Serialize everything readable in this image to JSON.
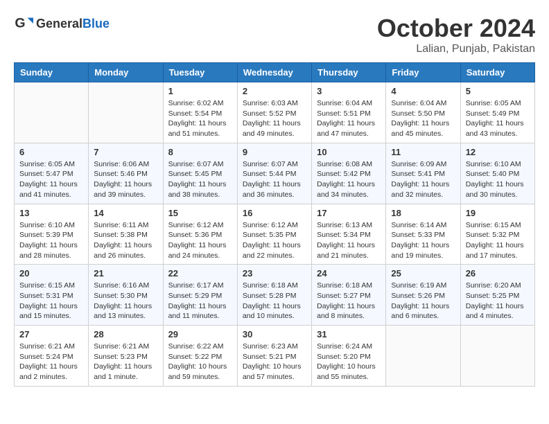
{
  "logo": {
    "text_general": "General",
    "text_blue": "Blue"
  },
  "title": {
    "month_year": "October 2024",
    "location": "Lalian, Punjab, Pakistan"
  },
  "headers": [
    "Sunday",
    "Monday",
    "Tuesday",
    "Wednesday",
    "Thursday",
    "Friday",
    "Saturday"
  ],
  "weeks": [
    [
      {
        "day": "",
        "info": ""
      },
      {
        "day": "",
        "info": ""
      },
      {
        "day": "1",
        "info": "Sunrise: 6:02 AM\nSunset: 5:54 PM\nDaylight: 11 hours and 51 minutes."
      },
      {
        "day": "2",
        "info": "Sunrise: 6:03 AM\nSunset: 5:52 PM\nDaylight: 11 hours and 49 minutes."
      },
      {
        "day": "3",
        "info": "Sunrise: 6:04 AM\nSunset: 5:51 PM\nDaylight: 11 hours and 47 minutes."
      },
      {
        "day": "4",
        "info": "Sunrise: 6:04 AM\nSunset: 5:50 PM\nDaylight: 11 hours and 45 minutes."
      },
      {
        "day": "5",
        "info": "Sunrise: 6:05 AM\nSunset: 5:49 PM\nDaylight: 11 hours and 43 minutes."
      }
    ],
    [
      {
        "day": "6",
        "info": "Sunrise: 6:05 AM\nSunset: 5:47 PM\nDaylight: 11 hours and 41 minutes."
      },
      {
        "day": "7",
        "info": "Sunrise: 6:06 AM\nSunset: 5:46 PM\nDaylight: 11 hours and 39 minutes."
      },
      {
        "day": "8",
        "info": "Sunrise: 6:07 AM\nSunset: 5:45 PM\nDaylight: 11 hours and 38 minutes."
      },
      {
        "day": "9",
        "info": "Sunrise: 6:07 AM\nSunset: 5:44 PM\nDaylight: 11 hours and 36 minutes."
      },
      {
        "day": "10",
        "info": "Sunrise: 6:08 AM\nSunset: 5:42 PM\nDaylight: 11 hours and 34 minutes."
      },
      {
        "day": "11",
        "info": "Sunrise: 6:09 AM\nSunset: 5:41 PM\nDaylight: 11 hours and 32 minutes."
      },
      {
        "day": "12",
        "info": "Sunrise: 6:10 AM\nSunset: 5:40 PM\nDaylight: 11 hours and 30 minutes."
      }
    ],
    [
      {
        "day": "13",
        "info": "Sunrise: 6:10 AM\nSunset: 5:39 PM\nDaylight: 11 hours and 28 minutes."
      },
      {
        "day": "14",
        "info": "Sunrise: 6:11 AM\nSunset: 5:38 PM\nDaylight: 11 hours and 26 minutes."
      },
      {
        "day": "15",
        "info": "Sunrise: 6:12 AM\nSunset: 5:36 PM\nDaylight: 11 hours and 24 minutes."
      },
      {
        "day": "16",
        "info": "Sunrise: 6:12 AM\nSunset: 5:35 PM\nDaylight: 11 hours and 22 minutes."
      },
      {
        "day": "17",
        "info": "Sunrise: 6:13 AM\nSunset: 5:34 PM\nDaylight: 11 hours and 21 minutes."
      },
      {
        "day": "18",
        "info": "Sunrise: 6:14 AM\nSunset: 5:33 PM\nDaylight: 11 hours and 19 minutes."
      },
      {
        "day": "19",
        "info": "Sunrise: 6:15 AM\nSunset: 5:32 PM\nDaylight: 11 hours and 17 minutes."
      }
    ],
    [
      {
        "day": "20",
        "info": "Sunrise: 6:15 AM\nSunset: 5:31 PM\nDaylight: 11 hours and 15 minutes."
      },
      {
        "day": "21",
        "info": "Sunrise: 6:16 AM\nSunset: 5:30 PM\nDaylight: 11 hours and 13 minutes."
      },
      {
        "day": "22",
        "info": "Sunrise: 6:17 AM\nSunset: 5:29 PM\nDaylight: 11 hours and 11 minutes."
      },
      {
        "day": "23",
        "info": "Sunrise: 6:18 AM\nSunset: 5:28 PM\nDaylight: 11 hours and 10 minutes."
      },
      {
        "day": "24",
        "info": "Sunrise: 6:18 AM\nSunset: 5:27 PM\nDaylight: 11 hours and 8 minutes."
      },
      {
        "day": "25",
        "info": "Sunrise: 6:19 AM\nSunset: 5:26 PM\nDaylight: 11 hours and 6 minutes."
      },
      {
        "day": "26",
        "info": "Sunrise: 6:20 AM\nSunset: 5:25 PM\nDaylight: 11 hours and 4 minutes."
      }
    ],
    [
      {
        "day": "27",
        "info": "Sunrise: 6:21 AM\nSunset: 5:24 PM\nDaylight: 11 hours and 2 minutes."
      },
      {
        "day": "28",
        "info": "Sunrise: 6:21 AM\nSunset: 5:23 PM\nDaylight: 11 hours and 1 minute."
      },
      {
        "day": "29",
        "info": "Sunrise: 6:22 AM\nSunset: 5:22 PM\nDaylight: 10 hours and 59 minutes."
      },
      {
        "day": "30",
        "info": "Sunrise: 6:23 AM\nSunset: 5:21 PM\nDaylight: 10 hours and 57 minutes."
      },
      {
        "day": "31",
        "info": "Sunrise: 6:24 AM\nSunset: 5:20 PM\nDaylight: 10 hours and 55 minutes."
      },
      {
        "day": "",
        "info": ""
      },
      {
        "day": "",
        "info": ""
      }
    ]
  ]
}
